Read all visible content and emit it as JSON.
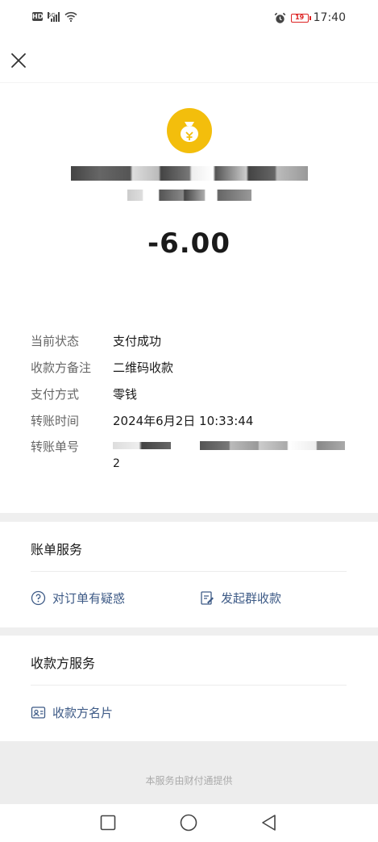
{
  "status_bar": {
    "hd": "HD",
    "network": "5G",
    "time": "17:40",
    "battery": "19"
  },
  "transaction": {
    "amount": "-6.00"
  },
  "details": [
    {
      "label": "当前状态",
      "value": "支付成功"
    },
    {
      "label": "收款方备注",
      "value": "二维码收款"
    },
    {
      "label": "支付方式",
      "value": "零钱"
    },
    {
      "label": "转账时间",
      "value": "2024年6月2日 10:33:44"
    },
    {
      "label": "转账单号",
      "value": "2"
    }
  ],
  "bill_service": {
    "title": "账单服务",
    "question_label": "对订单有疑惑",
    "group_collect_label": "发起群收款"
  },
  "payee_service": {
    "title": "收款方服务",
    "card_label": "收款方名片"
  },
  "footer": {
    "provider_text": "本服务由财付通提供"
  },
  "colors": {
    "avatar": "#f3be0c",
    "link": "#3d5a86"
  }
}
